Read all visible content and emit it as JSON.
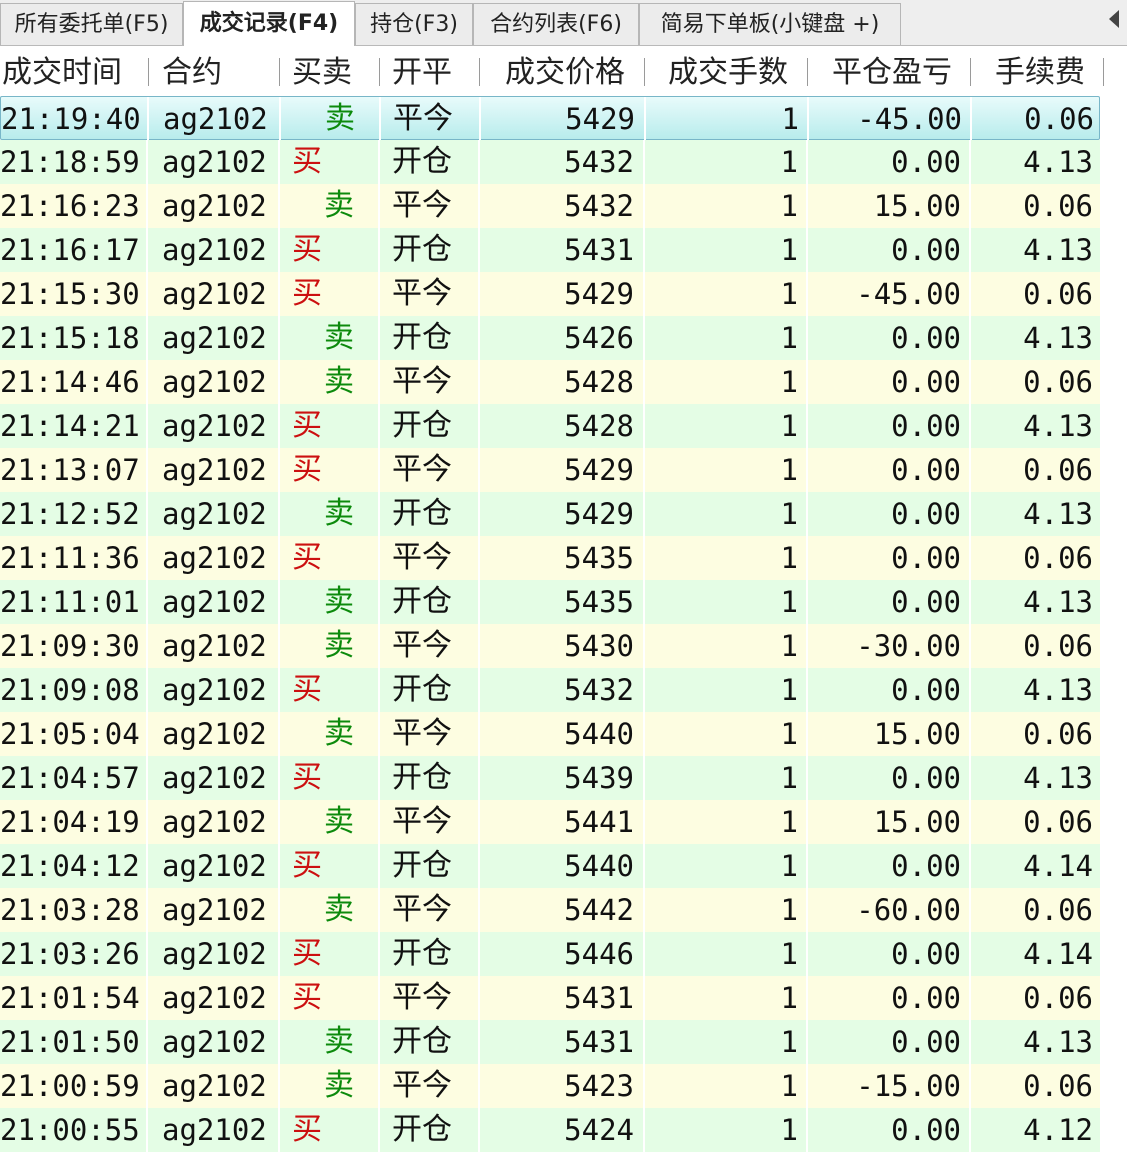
{
  "tabs": [
    {
      "label": "所有委托单(F5)",
      "active": false
    },
    {
      "label": "成交记录(F4)",
      "active": true
    },
    {
      "label": "持仓(F3)",
      "active": false
    },
    {
      "label": "合约列表(F6)",
      "active": false
    },
    {
      "label": "简易下单板(小键盘 +)",
      "active": false
    }
  ],
  "columns": [
    "成交时间",
    "合约",
    "买卖",
    "开平",
    "成交价格",
    "成交手数",
    "平仓盈亏",
    "手续费"
  ],
  "colors": {
    "buy": "#cc1010",
    "sell": "#0c8a0c",
    "row_odd": "#fdfde1",
    "row_even": "#e4fde5",
    "selected": "#b8ecec"
  },
  "rows": [
    {
      "time": "21:19:40",
      "contract": "ag2102",
      "side": "卖",
      "openclose": "平今",
      "price": "5429",
      "qty": "1",
      "pnl": "-45.00",
      "fee": "0.06"
    },
    {
      "time": "21:18:59",
      "contract": "ag2102",
      "side": "买",
      "openclose": "开仓",
      "price": "5432",
      "qty": "1",
      "pnl": "0.00",
      "fee": "4.13"
    },
    {
      "time": "21:16:23",
      "contract": "ag2102",
      "side": "卖",
      "openclose": "平今",
      "price": "5432",
      "qty": "1",
      "pnl": "15.00",
      "fee": "0.06"
    },
    {
      "time": "21:16:17",
      "contract": "ag2102",
      "side": "买",
      "openclose": "开仓",
      "price": "5431",
      "qty": "1",
      "pnl": "0.00",
      "fee": "4.13"
    },
    {
      "time": "21:15:30",
      "contract": "ag2102",
      "side": "买",
      "openclose": "平今",
      "price": "5429",
      "qty": "1",
      "pnl": "-45.00",
      "fee": "0.06"
    },
    {
      "time": "21:15:18",
      "contract": "ag2102",
      "side": "卖",
      "openclose": "开仓",
      "price": "5426",
      "qty": "1",
      "pnl": "0.00",
      "fee": "4.13"
    },
    {
      "time": "21:14:46",
      "contract": "ag2102",
      "side": "卖",
      "openclose": "平今",
      "price": "5428",
      "qty": "1",
      "pnl": "0.00",
      "fee": "0.06"
    },
    {
      "time": "21:14:21",
      "contract": "ag2102",
      "side": "买",
      "openclose": "开仓",
      "price": "5428",
      "qty": "1",
      "pnl": "0.00",
      "fee": "4.13"
    },
    {
      "time": "21:13:07",
      "contract": "ag2102",
      "side": "买",
      "openclose": "平今",
      "price": "5429",
      "qty": "1",
      "pnl": "0.00",
      "fee": "0.06"
    },
    {
      "time": "21:12:52",
      "contract": "ag2102",
      "side": "卖",
      "openclose": "开仓",
      "price": "5429",
      "qty": "1",
      "pnl": "0.00",
      "fee": "4.13"
    },
    {
      "time": "21:11:36",
      "contract": "ag2102",
      "side": "买",
      "openclose": "平今",
      "price": "5435",
      "qty": "1",
      "pnl": "0.00",
      "fee": "0.06"
    },
    {
      "time": "21:11:01",
      "contract": "ag2102",
      "side": "卖",
      "openclose": "开仓",
      "price": "5435",
      "qty": "1",
      "pnl": "0.00",
      "fee": "4.13"
    },
    {
      "time": "21:09:30",
      "contract": "ag2102",
      "side": "卖",
      "openclose": "平今",
      "price": "5430",
      "qty": "1",
      "pnl": "-30.00",
      "fee": "0.06"
    },
    {
      "time": "21:09:08",
      "contract": "ag2102",
      "side": "买",
      "openclose": "开仓",
      "price": "5432",
      "qty": "1",
      "pnl": "0.00",
      "fee": "4.13"
    },
    {
      "time": "21:05:04",
      "contract": "ag2102",
      "side": "卖",
      "openclose": "平今",
      "price": "5440",
      "qty": "1",
      "pnl": "15.00",
      "fee": "0.06"
    },
    {
      "time": "21:04:57",
      "contract": "ag2102",
      "side": "买",
      "openclose": "开仓",
      "price": "5439",
      "qty": "1",
      "pnl": "0.00",
      "fee": "4.13"
    },
    {
      "time": "21:04:19",
      "contract": "ag2102",
      "side": "卖",
      "openclose": "平今",
      "price": "5441",
      "qty": "1",
      "pnl": "15.00",
      "fee": "0.06"
    },
    {
      "time": "21:04:12",
      "contract": "ag2102",
      "side": "买",
      "openclose": "开仓",
      "price": "5440",
      "qty": "1",
      "pnl": "0.00",
      "fee": "4.14"
    },
    {
      "time": "21:03:28",
      "contract": "ag2102",
      "side": "卖",
      "openclose": "平今",
      "price": "5442",
      "qty": "1",
      "pnl": "-60.00",
      "fee": "0.06"
    },
    {
      "time": "21:03:26",
      "contract": "ag2102",
      "side": "买",
      "openclose": "开仓",
      "price": "5446",
      "qty": "1",
      "pnl": "0.00",
      "fee": "4.14"
    },
    {
      "time": "21:01:54",
      "contract": "ag2102",
      "side": "买",
      "openclose": "平今",
      "price": "5431",
      "qty": "1",
      "pnl": "0.00",
      "fee": "0.06"
    },
    {
      "time": "21:01:50",
      "contract": "ag2102",
      "side": "卖",
      "openclose": "开仓",
      "price": "5431",
      "qty": "1",
      "pnl": "0.00",
      "fee": "4.13"
    },
    {
      "time": "21:00:59",
      "contract": "ag2102",
      "side": "卖",
      "openclose": "平今",
      "price": "5423",
      "qty": "1",
      "pnl": "-15.00",
      "fee": "0.06"
    },
    {
      "time": "21:00:55",
      "contract": "ag2102",
      "side": "买",
      "openclose": "开仓",
      "price": "5424",
      "qty": "1",
      "pnl": "0.00",
      "fee": "4.12"
    }
  ]
}
